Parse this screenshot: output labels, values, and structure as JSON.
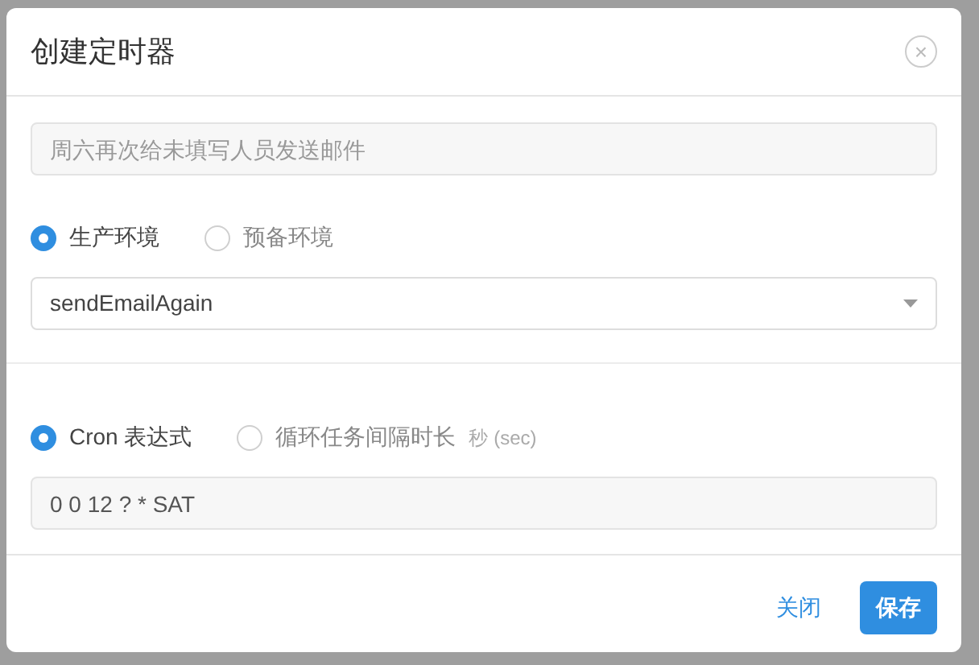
{
  "dialog": {
    "title": "创建定时器",
    "close_icon": "×"
  },
  "name_field": {
    "placeholder": "周六再次给未填写人员发送邮件"
  },
  "environment": [
    {
      "label": "生产环境",
      "selected": true
    },
    {
      "label": "预备环境",
      "selected": false
    }
  ],
  "job_select": {
    "value": "sendEmailAgain"
  },
  "schedule_type": [
    {
      "label": "Cron 表达式",
      "selected": true
    },
    {
      "label": "循环任务间隔时长",
      "hint": "秒 (sec)",
      "selected": false
    }
  ],
  "cron_field": {
    "value": "0 0 12 ? * SAT"
  },
  "buttons": [
    {
      "label": "关闭",
      "kind": "link"
    },
    {
      "label": "保存",
      "kind": "primary"
    }
  ]
}
